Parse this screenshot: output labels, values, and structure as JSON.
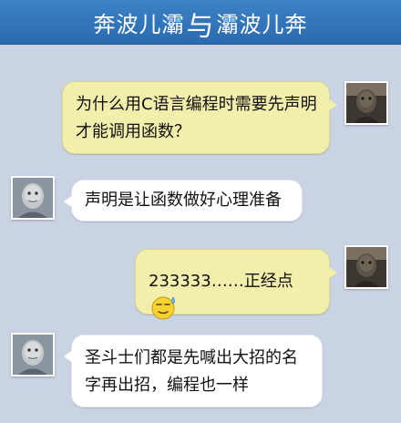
{
  "header": {
    "title_left": "奔波儿灞",
    "separator": "与",
    "title_right": "灞波儿奔"
  },
  "messages": [
    {
      "side": "right",
      "text": "为什么用C语言编程时需要先声明才能调用函数？"
    },
    {
      "side": "left",
      "text": "声明是让函数做好心理准备"
    },
    {
      "side": "right",
      "text": "233333……正经点",
      "emoji": "sweat-smile-emoji"
    },
    {
      "side": "left",
      "text": "圣斗士们都是先喊出大招的名字再出招，编程也一样"
    }
  ]
}
